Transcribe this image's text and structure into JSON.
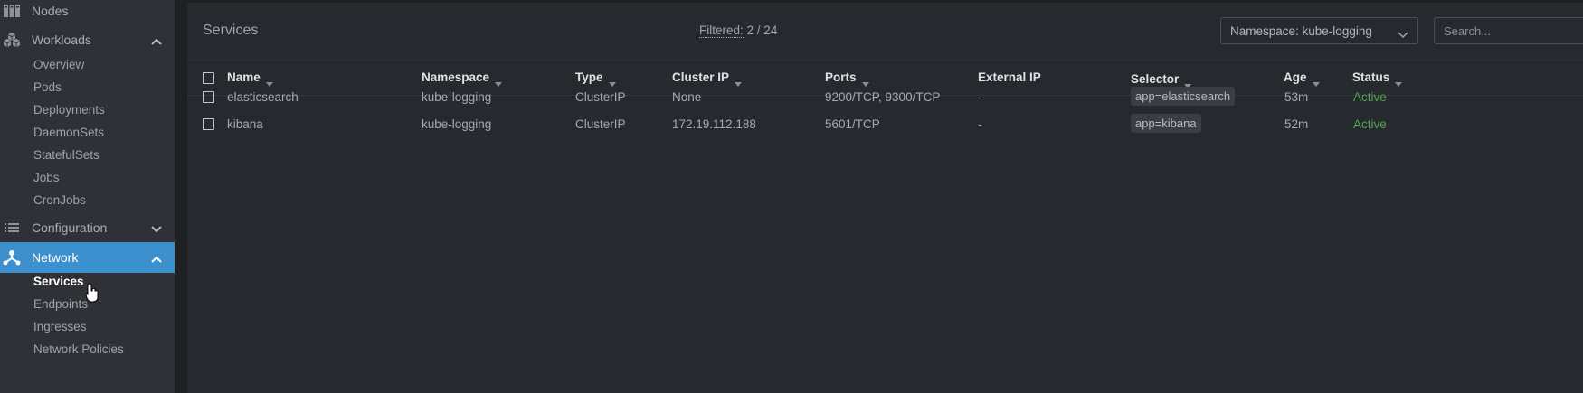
{
  "sidebar": {
    "items": [
      {
        "label": "Nodes",
        "icon": "nodes-icon",
        "expanded": null
      },
      {
        "label": "Workloads",
        "icon": "workloads-icon",
        "expanded": true,
        "children": [
          "Overview",
          "Pods",
          "Deployments",
          "DaemonSets",
          "StatefulSets",
          "Jobs",
          "CronJobs"
        ]
      },
      {
        "label": "Configuration",
        "icon": "list-icon",
        "expanded": false
      },
      {
        "label": "Network",
        "icon": "network-icon",
        "expanded": true,
        "active": true,
        "children": [
          "Services",
          "Endpoints",
          "Ingresses",
          "Network Policies"
        ],
        "active_child": "Services"
      }
    ]
  },
  "header": {
    "title": "Services",
    "filtered_label": "Filtered:",
    "filtered_value": "2 / 24",
    "namespace_select": "Namespace: kube-logging",
    "search_placeholder": "Search..."
  },
  "table": {
    "columns": [
      "Name",
      "Namespace",
      "Type",
      "Cluster IP",
      "Ports",
      "External IP",
      "Selector",
      "Age",
      "Status"
    ],
    "rows": [
      {
        "name": "elasticsearch",
        "namespace": "kube-logging",
        "type": "ClusterIP",
        "cluster_ip": "None",
        "ports": "9200/TCP, 9300/TCP",
        "external_ip": "-",
        "selector": "app=elasticsearch",
        "age": "53m",
        "status": "Active"
      },
      {
        "name": "kibana",
        "namespace": "kube-logging",
        "type": "ClusterIP",
        "cluster_ip": "172.19.112.188",
        "ports": "5601/TCP",
        "external_ip": "-",
        "selector": "app=kibana",
        "age": "52m",
        "status": "Active"
      }
    ]
  },
  "colors": {
    "sidebar_bg": "#2f3136",
    "active_accent": "#3d90ce",
    "main_bg": "#262a2e",
    "status_active": "#4fa54f"
  }
}
